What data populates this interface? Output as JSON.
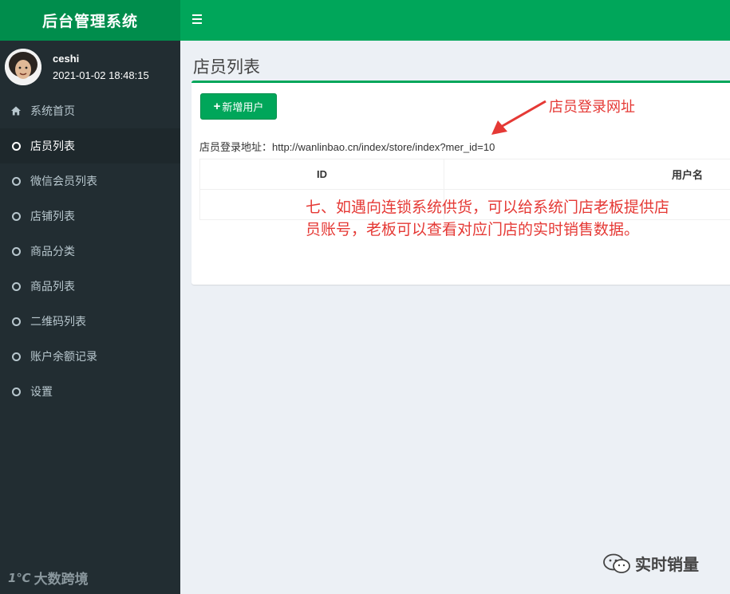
{
  "app": {
    "title": "后台管理系统"
  },
  "user": {
    "name": "ceshi",
    "login_time": "2021-01-02 18:48:15"
  },
  "menu": [
    {
      "label": "系统首页",
      "icon": "home-icon",
      "active": false
    },
    {
      "label": "店员列表",
      "icon": "circle-icon",
      "active": true
    },
    {
      "label": "微信会员列表",
      "icon": "circle-icon",
      "active": false
    },
    {
      "label": "店铺列表",
      "icon": "circle-icon",
      "active": false
    },
    {
      "label": "商品分类",
      "icon": "circle-icon",
      "active": false
    },
    {
      "label": "商品列表",
      "icon": "circle-icon",
      "active": false
    },
    {
      "label": "二维码列表",
      "icon": "circle-icon",
      "active": false
    },
    {
      "label": "账户余额记录",
      "icon": "circle-icon",
      "active": false
    },
    {
      "label": "设置",
      "icon": "circle-icon",
      "active": false
    }
  ],
  "page": {
    "title": "店员列表",
    "add_button": "新增用户",
    "login_url_label": "店员登录地址：",
    "login_url": "http://wanlinbao.cn/index/store/index?mer_id=10"
  },
  "table": {
    "columns": [
      "ID",
      "用户名"
    ]
  },
  "annotations": {
    "label": "店员登录网址",
    "note": "七、如遇向连锁系统供货，可以给系统门店老板提供店员账号，老板可以查看对应门店的实时销售数据。"
  },
  "watermarks": {
    "left": "大数跨境",
    "left_logo": "1℃",
    "right": "实时销量"
  },
  "colors": {
    "brand_green": "#00a65a",
    "brand_green_dark": "#008d4c",
    "sidebar": "#222d32",
    "annotation_red": "#e53935"
  }
}
